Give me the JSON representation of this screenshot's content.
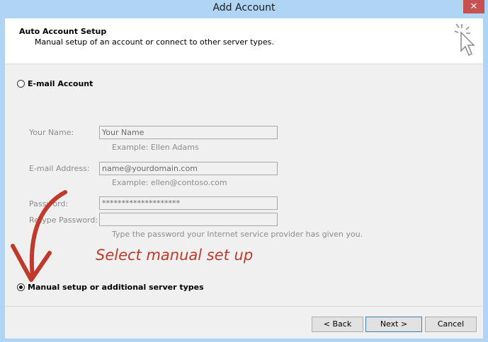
{
  "window": {
    "title": "Add Account",
    "close_glyph": "✕"
  },
  "header": {
    "title": "Auto Account Setup",
    "subtitle": "Manual setup of an account or connect to other server types.",
    "icon": "wizard-cursor-icon"
  },
  "email_account": {
    "label": "E-mail Account",
    "selected": false
  },
  "form": {
    "your_name": {
      "label": "Your Name:",
      "value": "Your Name",
      "example": "Example: Ellen Adams"
    },
    "email": {
      "label": "E-mail Address:",
      "value": "name@yourdomain.com",
      "example": "Example: ellen@contoso.com"
    },
    "password": {
      "label": "Password:",
      "value": "********************"
    },
    "retype_password": {
      "label": "Retype Password:",
      "value": ""
    },
    "password_hint": "Type the password your Internet service provider has given you."
  },
  "annotation": {
    "text": "Select manual set up",
    "color": "#c0392b"
  },
  "manual_setup": {
    "label": "Manual setup or additional server types",
    "selected": true
  },
  "buttons": {
    "back": "< Back",
    "next": "Next >",
    "cancel": "Cancel"
  }
}
